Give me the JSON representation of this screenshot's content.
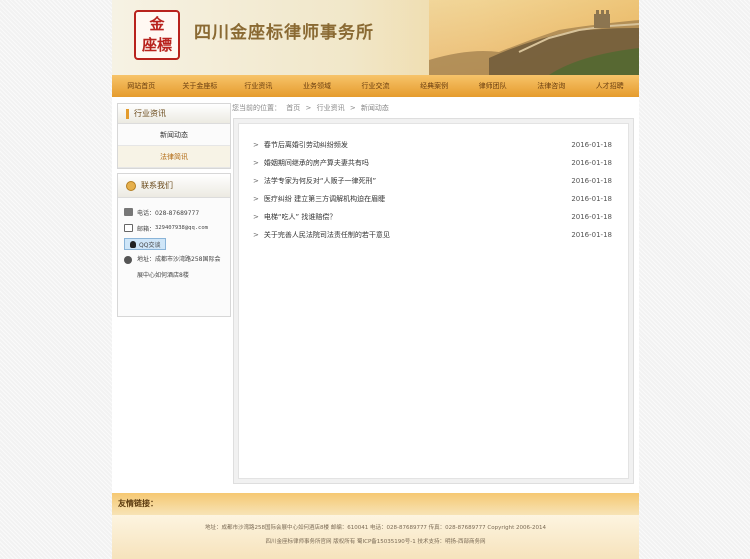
{
  "header": {
    "logo_line1": "金",
    "logo_line2": "座標",
    "site_title": "四川金座标律师事务所"
  },
  "nav": {
    "items": [
      "网站首页",
      "关于金座标",
      "行业资讯",
      "业务领域",
      "行业交流",
      "经典案例",
      "律师团队",
      "法律咨询",
      "人才招聘"
    ]
  },
  "sidebar": {
    "section_title": "行业资讯",
    "items": [
      "新闻动态",
      "法律简讯"
    ],
    "contact_title": "联系我们",
    "phone_label": "电话：028-87689777",
    "email_label": "邮箱：",
    "email_value": "329407938@qq.com",
    "qq_label": "QQ交谈",
    "address_line1": "地址：成都市沙湾路258国际会",
    "address_line2": "展中心如何酒店8楼"
  },
  "breadcrumb": {
    "prefix": "您当前的位置：",
    "home": "首页",
    "sep1": ">",
    "section": "行业资讯",
    "sep2": ">",
    "current": "新闻动态"
  },
  "news": [
    {
      "title": "春节后离婚引劳动纠纷频发",
      "date": "2016-01-18"
    },
    {
      "title": "婚姻期间继承的房产算夫妻共有吗",
      "date": "2016-01-18"
    },
    {
      "title": "法学专家为何反对“人贩子一律死刑”",
      "date": "2016-01-18"
    },
    {
      "title": "医疗纠纷 建立第三方调解机构迫在眉睫",
      "date": "2016-01-18"
    },
    {
      "title": "电梯“吃人” 找谁赔偿？",
      "date": "2016-01-18"
    },
    {
      "title": "关于完善人民法院司法责任制的若干意见",
      "date": "2016-01-18"
    }
  ],
  "footer": {
    "friend_links": "友情链接：",
    "line1": "地址：成都市沙湾路258国际会展中心如何酒店8楼 邮编：610041 电话：028-87689777 传真：028-87689777 Copyright 2006-2014",
    "line2": "四川金座标律师事务所官网 版权所有 蜀ICP备15035190号-1 技术支持：明扬-西部商务网"
  },
  "colors": {
    "nav_start": "#f7c46a",
    "nav_end": "#e59b2d",
    "seal_red": "#b8221d",
    "accent": "#e39b2c"
  }
}
